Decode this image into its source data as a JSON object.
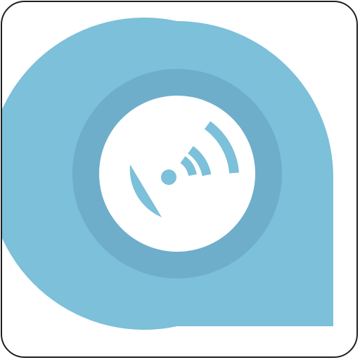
{
  "icon": {
    "name": "disc-signal-pin-icon",
    "colors": {
      "tile_background": "#ffffff",
      "tile_border": "#1f1f1f",
      "pin_fill": "#7cc0da",
      "ring_fill": "#6eaecb",
      "disc_fill": "#ffffff",
      "glyph_fill": "#7cc0da"
    }
  }
}
